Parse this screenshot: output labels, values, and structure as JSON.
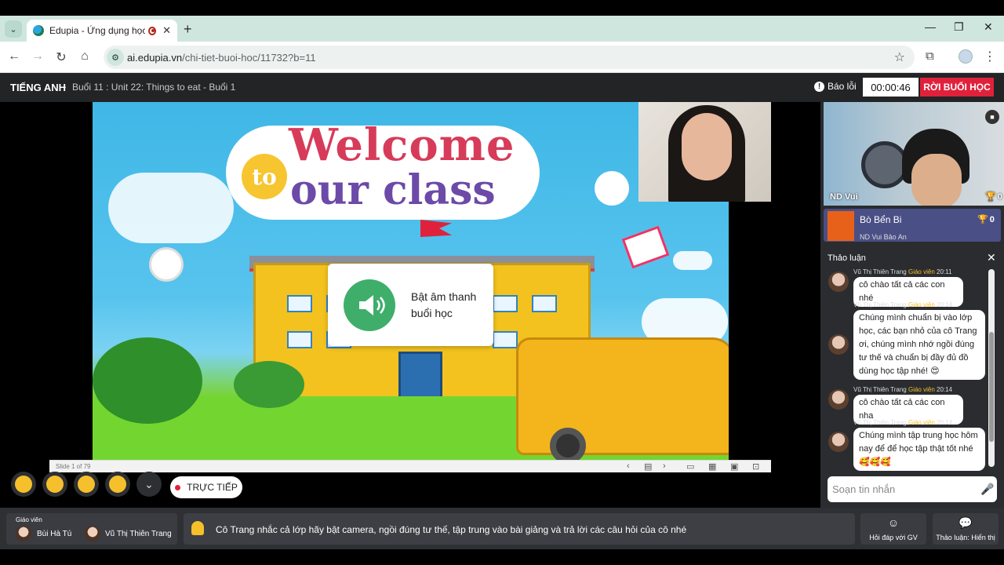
{
  "browser": {
    "tab_title": "Edupia - Ứng dụng học Tiế",
    "url_host": "ai.edupia.vn",
    "url_path": "/chi-tiet-buoi-hoc/11732?b=11"
  },
  "header": {
    "subject": "TIẾNG ANH",
    "separator": "-",
    "lesson": "Buổi 11 : Unit 22: Things to eat - Buổi 1",
    "report_label": "Báo lỗi",
    "timer": "00:00:46",
    "leave_label": "RỜI BUỔI HỌC"
  },
  "slide": {
    "line1": "Welcome",
    "to": "to",
    "line2": "our class",
    "counter": "Slide 1 of 79"
  },
  "sound_prompt": {
    "text": "Bật âm thanh buổi học"
  },
  "reactions": [
    "neutral-face",
    "grinning-face",
    "heart-eyes-face",
    "smiling-face"
  ],
  "live_label": "TRỰC TIẾP",
  "student": {
    "name": "ND Vui",
    "score": "0"
  },
  "team": {
    "name": "Bò Bển Bi",
    "score": "0",
    "members": "ND Vui        Bảo An"
  },
  "chat": {
    "title": "Thảo luận",
    "messages": [
      {
        "sender": "Vũ Thị Thiên Trang",
        "role": "Giáo viên",
        "time": "20:11",
        "text": "cô chào tất cả các con nhé"
      },
      {
        "sender": "Vũ Thị Thiên Trang",
        "role": "Giáo viên",
        "time": "20:14",
        "text": "Chúng mình chuẩn bị vào lớp học, các bạn nhỏ của cô Trang ơi, chúng mình nhớ ngồi đúng tư thế và chuẩn bị đầy đủ đồ dùng học tập nhé! 😍"
      },
      {
        "sender": "Vũ Thị Thiên Trang",
        "role": "Giáo viên",
        "time": "20:14",
        "text": "cô chào tất cả các con nha"
      },
      {
        "sender": "Vũ Thị Thiên Trang",
        "role": "Giáo viên",
        "time": "20:14",
        "text": "Chúng mình tập trung học hôm nay để để học tập thật tốt nhé 🥰🥰🥰"
      }
    ],
    "compose_placeholder": "Soạn tin nhắn"
  },
  "bottom": {
    "teachers_label": "Giáo viên",
    "teacher1": "Bùi Hà Tú",
    "teacher2": "Vũ Thị Thiên Trang",
    "notice": "Cô Trang nhắc cả lớp hãy bật camera, ngồi đúng tư thế, tập trung vào bài giảng và trả lời các câu hỏi của cô nhé",
    "qa_label": "Hỏi đáp với GV",
    "discussion_label": "Thảo luận: Hiển thị"
  },
  "colors": {
    "accent_red": "#e0213b",
    "sound_green": "#3fae6b",
    "teacher_role": "#f5c02b"
  }
}
